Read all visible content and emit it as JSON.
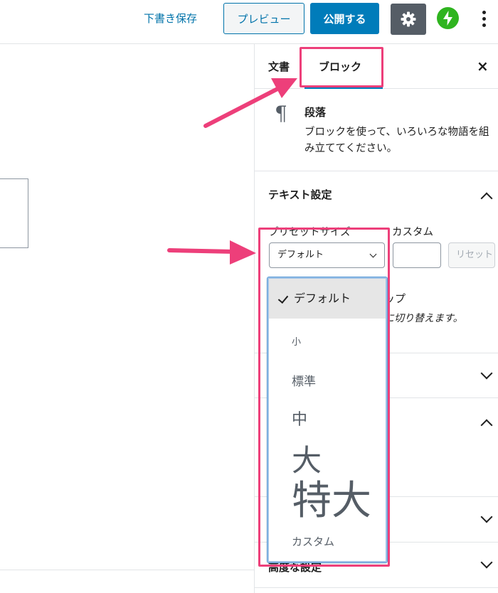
{
  "toolbar": {
    "save_draft": "下書き保存",
    "preview": "プレビュー",
    "publish": "公開する",
    "settings_icon": "gear-icon",
    "jetpack_icon": "jetpack-bolt-icon",
    "more_icon": "vertical-ellipsis-icon"
  },
  "sidebar": {
    "tabs": [
      {
        "label": "文書"
      },
      {
        "label": "ブロック"
      }
    ],
    "close_glyph": "×",
    "block_card": {
      "icon": "pilcrow-icon",
      "icon_glyph": "¶",
      "title": "段落",
      "description": "ブロックを使って、いろいろな物語を組み立ててください。"
    },
    "text_settings": {
      "title": "テキスト設定",
      "preset_label": "プリセットサイズ",
      "custom_label": "カスタム",
      "selected_value": "デフォルト",
      "reset_label": "リセット",
      "dropcap_title": "ップ",
      "dropcap_help": "に切り替えます。"
    },
    "advanced": {
      "title": "高度な設定"
    }
  },
  "dropdown": {
    "options": [
      {
        "label": "デフォルト",
        "selected": true
      },
      {
        "label": "小",
        "selected": false
      },
      {
        "label": "標準",
        "selected": false
      },
      {
        "label": "中",
        "selected": false
      },
      {
        "label": "大",
        "selected": false
      },
      {
        "label": "特大",
        "selected": false
      },
      {
        "label": "カスタム",
        "selected": false
      }
    ]
  },
  "colors": {
    "primary": "#007cba",
    "link": "#0073aa",
    "settings_bg": "#555d66",
    "jetpack": "#2fb41f",
    "annotation": "#ed3f7a",
    "focus": "#5b9dd9"
  }
}
